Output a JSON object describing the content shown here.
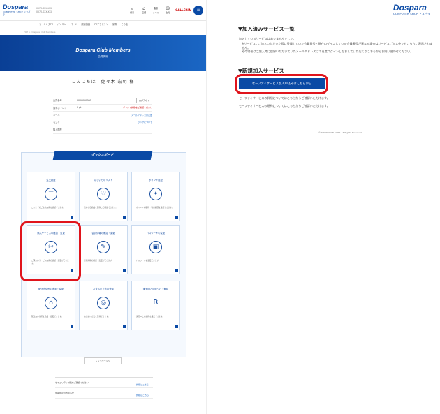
{
  "header": {
    "logo": "Dospara",
    "logo_sub": "COMPUTER SHOP ドスパラ",
    "phone1": "0570-0XX-XXX",
    "phone2": "0570-0XX-XXX",
    "icons": [
      {
        "name": "search-icon",
        "glyph": "⌕",
        "label": "検索"
      },
      {
        "name": "shop-icon",
        "glyph": "⌂",
        "label": "店舗"
      },
      {
        "name": "mail-icon",
        "glyph": "✉",
        "label": "メール"
      },
      {
        "name": "user-icon",
        "glyph": "☺",
        "label": "会員"
      }
    ],
    "brand2": "GALLERIA",
    "menu_icon": "≡"
  },
  "nav": [
    "ゲーミングPC",
    "パソコン",
    "パーツ",
    "周辺機器",
    "PCアクセサリ",
    "家電",
    "その他"
  ],
  "breadcrumb": "TOP > Dospara Club Members",
  "banner": {
    "title": "Dospara Club Members",
    "sub": "会員情報"
  },
  "greeting": "こんにちは　佐々木 宏明 様",
  "info_rows": [
    {
      "key": "会員番号",
      "value": "0000000000",
      "action": "ログアウト",
      "kind": "btn"
    },
    {
      "key": "保有ポイント",
      "value": "0 pt",
      "action": "ポイント詳細をご確認ください",
      "kind": "red"
    },
    {
      "key": "メール",
      "value": "",
      "action": "メールアドレスの変更",
      "kind": "link"
    },
    {
      "key": "ランク",
      "value": "",
      "action": "ランクについて",
      "kind": "link"
    },
    {
      "key": "購入履歴",
      "value": "",
      "action": "",
      "kind": "none"
    }
  ],
  "dashboard": {
    "title": "ダッシュボード",
    "cards": [
      {
        "title": "注文履歴",
        "icon": "list-icon",
        "glyph": "☰",
        "desc": "これまでのご注文内容を確認できます。"
      },
      {
        "title": "ほしいものリスト",
        "icon": "heart-icon",
        "glyph": "♡",
        "desc": "気になる商品を保存して確認できます。"
      },
      {
        "title": "ポイント履歴",
        "icon": "point-icon",
        "glyph": "✦",
        "desc": "ポイントの獲得・利用履歴を確認できます。"
      },
      {
        "title": "購入サービスの確認・変更",
        "icon": "wrench-icon",
        "glyph": "✂",
        "desc": "ご購入のサービス内容の確認・変更ができます。"
      },
      {
        "title": "会員情報の確認・変更",
        "icon": "profile-icon",
        "glyph": "✎",
        "desc": "登録情報の確認・変更ができます。"
      },
      {
        "title": "パスワードの変更",
        "icon": "lock-icon",
        "glyph": "▣",
        "desc": "パスワードを変更できます。"
      },
      {
        "title": "配送先住所の追加・変更",
        "icon": "home-icon",
        "glyph": "⌂",
        "desc": "配送先の住所を追加・変更できます。"
      },
      {
        "title": "お支払い方法の登録",
        "icon": "card-icon",
        "glyph": "◎",
        "desc": "お支払い方法を登録できます。"
      },
      {
        "title": "楽天IDとの紐づけ・解除",
        "icon": "rakuten-icon",
        "glyph": "R",
        "desc": "楽天IDとの連携を設定できます。"
      }
    ]
  },
  "pager_label": "トップページへ",
  "news": [
    {
      "text": "セキュリティ対策をご確認ください",
      "link": "詳細はこちら"
    },
    {
      "text": "会員限定のお知らせ",
      "link": "詳細はこちら"
    }
  ],
  "right": {
    "logo": "Dospara",
    "logo_sub": "COMPUTER SHOP ドスパラ",
    "sec1": "▼加入済みサービス一覧",
    "sec1_lines": [
      "加入しているサービスはありませんでした。",
      "※サービスにご加入いただいた際に登録していた会員番号と現在ログインしている会員番号が異なる場合はサービスご加入中でもこちらに表示されません。",
      "その場合はご加入時に登録いただいていたメールアドレスにて再度ログインしなおしていただくかこちらからお問い合わせください。"
    ],
    "sec2": "▼新規加入サービス",
    "cta": "セーフティサービス加入申込みはこちらから",
    "info1": "セーフティサービスの詳細についてはこちらからご確認いただけます。",
    "info2": "セーフティサービスの規約についてはこちらからご確認いただけます。",
    "copyright": "© THIRDWAVE CORP. All Rights Reserved."
  }
}
